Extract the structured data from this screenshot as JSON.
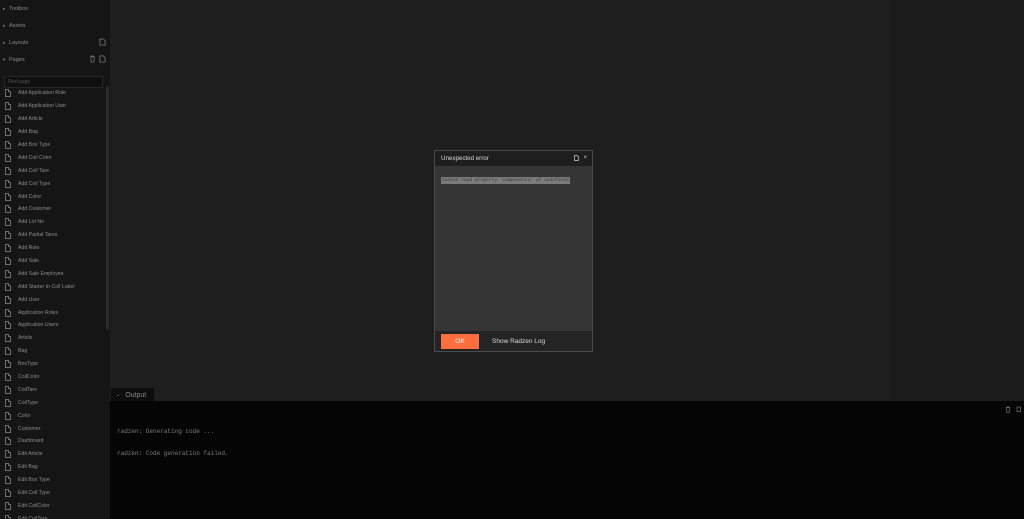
{
  "sidebar": {
    "sections": [
      {
        "caret": "▸",
        "label": "Toolbox"
      },
      {
        "caret": "▸",
        "label": "Assets"
      },
      {
        "caret": "▸",
        "label": "Layouts"
      },
      {
        "caret": "▾",
        "label": "Pages"
      }
    ],
    "search_placeholder": "Find page",
    "pages": [
      "Add Application Role",
      "Add Application User",
      "Add Article",
      "Add Bag",
      "Add Box Type",
      "Add Coil Color",
      "Add Coil Tare",
      "Add Coil Type",
      "Add Color",
      "Add Customer",
      "Add Lot No",
      "Add Partial Tares",
      "Add Role",
      "Add Sale",
      "Add Sale Employee",
      "Add Starter In Coil Label",
      "Add User",
      "Application Roles",
      "Application Users",
      "Article",
      "Bag",
      "BoxType",
      "CoilColor",
      "CoilTare",
      "CoilType",
      "Color",
      "Customer",
      "Dashboard",
      "Edit Article",
      "Edit Bag",
      "Edit Box Type",
      "Edit Coil Type",
      "Edit CoilColor",
      "Edit CoilTare"
    ]
  },
  "output": {
    "tab_label": "Output",
    "lines": [
      "radzen: Generating code ...",
      "radzen: Code generation failed."
    ]
  },
  "dialog": {
    "title": "Unexpected error",
    "error_message": "Cannot read property 'components' of undefined",
    "ok_label": "OK",
    "log_label": "Show Radzen Log"
  },
  "colors": {
    "accent": "#ff6e3c",
    "sidebar_bg": "#151515",
    "canvas_bg": "#1e1e1e",
    "output_bg": "#050505"
  }
}
